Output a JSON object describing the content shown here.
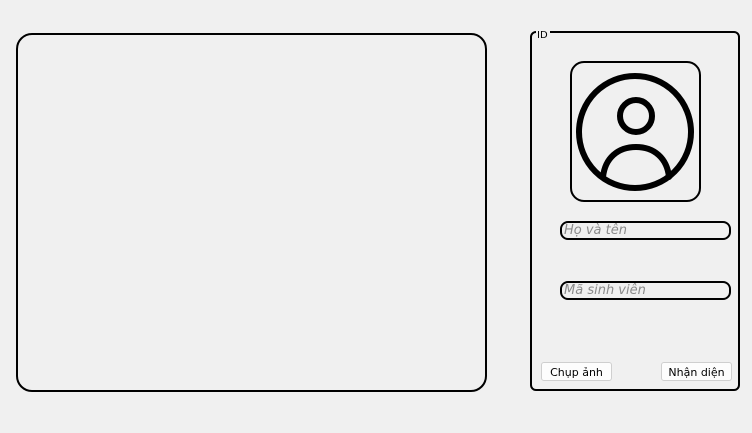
{
  "id_group": {
    "title": "ID"
  },
  "avatar": {
    "icon": "user-avatar-icon"
  },
  "form": {
    "name_placeholder": "Họ và tên",
    "name_value": "",
    "student_id_placeholder": "Mã sinh viên",
    "student_id_value": ""
  },
  "buttons": {
    "capture_label": "Chụp ảnh",
    "recognize_label": "Nhận diện"
  },
  "colors": {
    "background": "#f0f0f0",
    "border": "#000000",
    "placeholder": "#8a8a8a"
  }
}
